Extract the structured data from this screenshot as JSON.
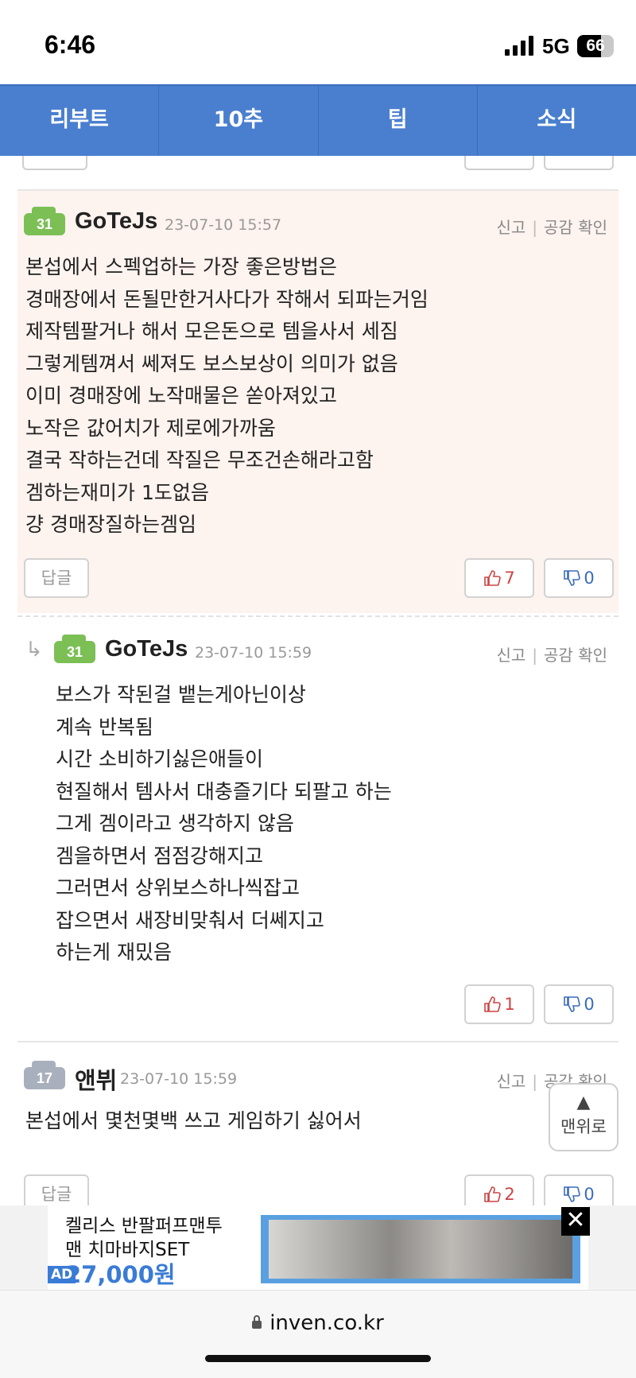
{
  "status_bar": {
    "time": "6:46",
    "network": "5G",
    "battery": "66"
  },
  "tabs": [
    "리부트",
    "10추",
    "팁",
    "소식"
  ],
  "comments": [
    {
      "level": "31",
      "nickname": "GoTeJs",
      "date": "23-07-10 15:57",
      "report": "신고",
      "like_check": "공감 확인",
      "text": "본섭에서 스펙업하는 가장 좋은방법은\n경매장에서 돈될만한거사다가 작해서 되파는거임\n제작템팔거나 해서 모은돈으로 템을사서 세짐\n그렇게템껴서 쎄져도 보스보상이 의미가 없음\n이미 경매장에 노작매물은 쏟아져있고\n노작은 값어치가 제로에가까움\n결국 작하는건데 작질은 무조건손해라고함\n겜하는재미가 1도없음\n걍 경매장질하는겜임",
      "reply_label": "답글",
      "up": "7",
      "down": "0"
    },
    {
      "level": "31",
      "nickname": "GoTeJs",
      "date": "23-07-10 15:59",
      "report": "신고",
      "like_check": "공감 확인",
      "text": "보스가 작된걸 뱉는게아닌이상\n계속 반복됨\n시간 소비하기싫은애들이\n현질해서 템사서 대충즐기다 되팔고 하는\n그게 겜이라고 생각하지 않음\n겜을하면서 점점강해지고\n그러면서 상위보스하나씩잡고\n잡으면서 새장비맞춰서 더쎄지고\n하는게 재밌음",
      "up": "1",
      "down": "0"
    },
    {
      "level": "17",
      "nickname": "앤뷔",
      "date": "23-07-10 15:59",
      "report": "신고",
      "like_check": "공감 확인",
      "text": "본섭에서 몇천몇백 쓰고 게임하기 싫어서",
      "reply_label": "답글",
      "up": "2",
      "down": "0"
    }
  ],
  "top_button": {
    "arrow": "▲",
    "label": "맨위로"
  },
  "ad": {
    "line1": "켈리스 반팔퍼프맨투",
    "line2": "맨 치마바지SET",
    "price": "27,000원",
    "tag": "AD",
    "close": "✕"
  },
  "browser": {
    "url": "inven.co.kr"
  },
  "colors": {
    "tab_bg": "#4a7fd0",
    "best_bg": "#fdf3ef",
    "up": "#cc4444",
    "down": "#3b6cbc"
  }
}
